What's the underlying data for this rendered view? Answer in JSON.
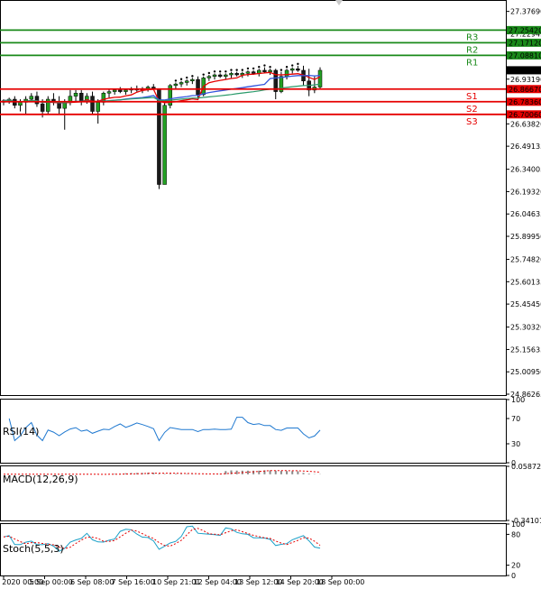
{
  "chart_data": {
    "type": "candlestick",
    "price_axis": {
      "ylim": [
        24.86265,
        27.44
      ],
      "ticks": [
        "27.37690",
        "27.22945",
        "26.93190",
        "26.78445",
        "26.63820",
        "26.49135",
        "26.34005",
        "26.19320",
        "26.04635",
        "25.89950",
        "25.74820",
        "25.60135",
        "25.45450",
        "25.30320",
        "25.15635",
        "25.00950",
        "24.86265"
      ]
    },
    "current_price": "26.99025",
    "levels": [
      {
        "name": "R3",
        "value": 27.2542,
        "tag": "27.25420",
        "color": "#1a8a1a"
      },
      {
        "name": "R2",
        "value": 27.1712,
        "tag": "27.17120",
        "color": "#1a8a1a"
      },
      {
        "name": "R1",
        "value": 27.0881,
        "tag": "27.08810",
        "color": "#1a8a1a"
      },
      {
        "name": "S1",
        "value": 26.8667,
        "tag": "26.86670",
        "color": "#e60000"
      },
      {
        "name": "S2",
        "value": 26.7836,
        "tag": "26.78360",
        "color": "#e60000"
      },
      {
        "name": "S3",
        "value": 26.7006,
        "tag": "26.70060",
        "color": "#e60000"
      }
    ],
    "time_axis": [
      "4 Sep 2020 00:00",
      "5 Sep 00:00",
      "6 Sep 08:00",
      "7 Sep 16:00",
      "10 Sep 21:01",
      "12 Sep 04:00",
      "13 Sep 12:00",
      "14 Sep 20:00",
      "18 Sep 00:00"
    ],
    "candles": [
      [
        26.78,
        26.8,
        26.76,
        26.79
      ],
      [
        26.79,
        26.81,
        26.77,
        26.8
      ],
      [
        26.8,
        26.82,
        26.74,
        26.76
      ],
      [
        26.76,
        26.8,
        26.72,
        26.78
      ],
      [
        26.78,
        26.82,
        26.7,
        26.8
      ],
      [
        26.8,
        26.84,
        26.78,
        26.82
      ],
      [
        26.82,
        26.85,
        26.75,
        26.77
      ],
      [
        26.77,
        26.8,
        26.68,
        26.72
      ],
      [
        26.72,
        26.82,
        26.7,
        26.8
      ],
      [
        26.8,
        26.84,
        26.76,
        26.78
      ],
      [
        26.78,
        26.82,
        26.7,
        26.74
      ],
      [
        26.74,
        26.8,
        26.6,
        26.78
      ],
      [
        26.78,
        26.86,
        26.76,
        26.82
      ],
      [
        26.82,
        26.86,
        26.78,
        26.84
      ],
      [
        26.84,
        26.86,
        26.76,
        26.79
      ],
      [
        26.79,
        26.84,
        26.77,
        26.82
      ],
      [
        26.82,
        26.85,
        26.7,
        26.72
      ],
      [
        26.72,
        26.8,
        26.64,
        26.78
      ],
      [
        26.78,
        26.85,
        26.76,
        26.84
      ],
      [
        26.84,
        26.87,
        26.81,
        26.85
      ],
      [
        26.85,
        26.87,
        26.83,
        26.86
      ],
      [
        26.86,
        26.88,
        26.84,
        26.85
      ],
      [
        26.85,
        26.87,
        26.83,
        26.86
      ],
      [
        26.86,
        26.88,
        26.84,
        26.87
      ],
      [
        26.87,
        26.89,
        26.85,
        26.86
      ],
      [
        26.86,
        26.88,
        26.84,
        26.87
      ],
      [
        26.87,
        26.89,
        26.85,
        26.88
      ],
      [
        26.88,
        26.9,
        26.86,
        26.87
      ],
      [
        26.87,
        26.86,
        26.21,
        26.24
      ],
      [
        26.24,
        26.78,
        26.24,
        26.76
      ],
      [
        26.76,
        26.9,
        26.74,
        26.89
      ],
      [
        26.89,
        26.91,
        26.87,
        26.9
      ],
      [
        26.9,
        26.92,
        26.88,
        26.91
      ],
      [
        26.91,
        26.93,
        26.89,
        26.92
      ],
      [
        26.92,
        26.94,
        26.9,
        26.93
      ],
      [
        26.93,
        26.95,
        26.8,
        26.83
      ],
      [
        26.83,
        26.95,
        26.82,
        26.94
      ],
      [
        26.94,
        26.96,
        26.92,
        26.95
      ],
      [
        26.95,
        26.97,
        26.93,
        26.96
      ],
      [
        26.96,
        26.97,
        26.94,
        26.95
      ],
      [
        26.95,
        26.97,
        26.93,
        26.96
      ],
      [
        26.96,
        26.98,
        26.94,
        26.97
      ],
      [
        26.97,
        26.98,
        26.95,
        26.96
      ],
      [
        26.96,
        26.98,
        26.94,
        26.97
      ],
      [
        26.97,
        26.99,
        26.95,
        26.98
      ],
      [
        26.98,
        26.99,
        26.96,
        26.97
      ],
      [
        26.97,
        27.0,
        26.95,
        26.99
      ],
      [
        26.99,
        27.01,
        26.97,
        26.98
      ],
      [
        26.98,
        27.0,
        26.96,
        26.99
      ],
      [
        26.99,
        27.0,
        26.8,
        26.85
      ],
      [
        26.85,
        26.98,
        26.84,
        26.95
      ],
      [
        26.95,
        27.0,
        26.93,
        26.99
      ],
      [
        26.99,
        27.01,
        26.97,
        27.0
      ],
      [
        27.0,
        27.02,
        26.98,
        26.99
      ],
      [
        26.99,
        27.02,
        26.89,
        26.92
      ],
      [
        26.92,
        27.0,
        26.82,
        26.86
      ],
      [
        26.86,
        26.95,
        26.84,
        26.88
      ],
      [
        26.88,
        27.01,
        26.87,
        26.99
      ]
    ],
    "indicators": [
      {
        "name": "RSI(14)",
        "ticks": [
          "100",
          "70",
          "30",
          "0"
        ],
        "ylim": [
          0,
          100
        ]
      },
      {
        "name": "MACD(12,26,9)",
        "ticks": [
          "0.058729",
          "-0.341012"
        ],
        "ylim": [
          -0.341012,
          0.058729
        ]
      },
      {
        "name": "Stoch(5,5,3)",
        "ticks": [
          "100",
          "80",
          "20",
          "0"
        ],
        "ylim": [
          0,
          100
        ]
      }
    ]
  }
}
